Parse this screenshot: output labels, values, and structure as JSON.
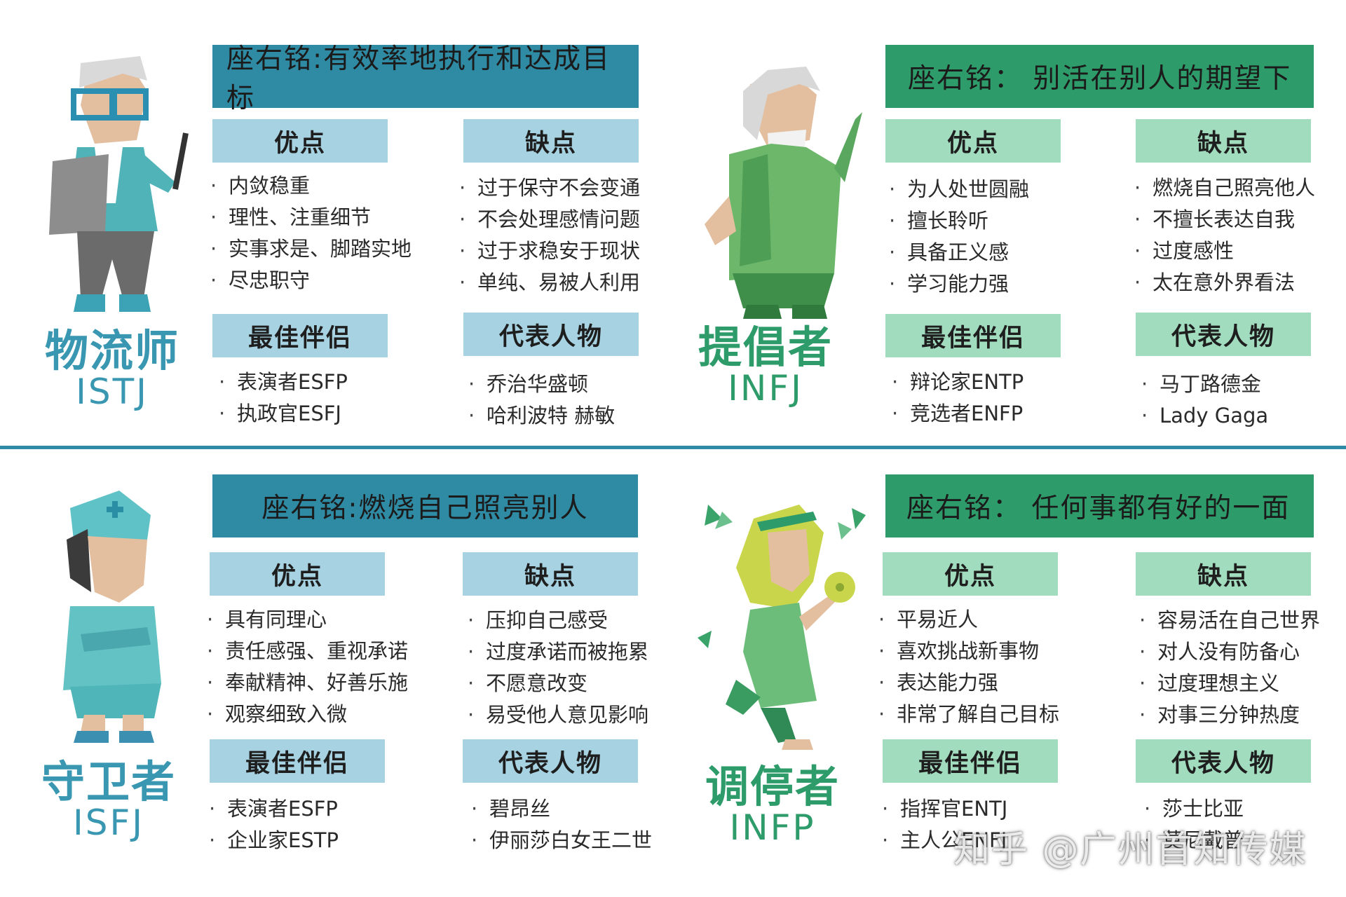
{
  "panels": {
    "istj": {
      "name": "物流师",
      "code": "ISTJ",
      "motto": "座右铭:有效率地执行和达成目标",
      "pros_label": "优点",
      "pros": [
        "内敛稳重",
        "理性、注重细节",
        "实事求是、脚踏实地",
        "尽忠职守"
      ],
      "cons_label": "缺点",
      "cons": [
        "过于保守不会变通",
        "不会处理感情问题",
        "过于求稳安于现状",
        "单纯、易被人利用"
      ],
      "partner_label": "最佳伴侣",
      "partners": [
        "表演者ESFP",
        "执政官ESFJ"
      ],
      "figures_label": "代表人物",
      "figures": [
        "乔治华盛顿",
        "哈利波特 赫敏"
      ]
    },
    "infj": {
      "name": "提倡者",
      "code": "INFJ",
      "motto": "座右铭：  别活在别人的期望下",
      "pros_label": "优点",
      "pros": [
        "为人处世圆融",
        "擅长聆听",
        "具备正义感",
        "学习能力强"
      ],
      "cons_label": "缺点",
      "cons": [
        "燃烧自己照亮他人",
        "不擅长表达自我",
        "过度感性",
        "太在意外界看法"
      ],
      "partner_label": "最佳伴侣",
      "partners": [
        "辩论家ENTP",
        "竞选者ENFP"
      ],
      "figures_label": "代表人物",
      "figures": [
        "马丁路德金",
        "Lady Gaga"
      ]
    },
    "isfj": {
      "name": "守卫者",
      "code": "ISFJ",
      "motto": "座右铭:燃烧自己照亮别人",
      "pros_label": "优点",
      "pros": [
        "具有同理心",
        "责任感强、重视承诺",
        "奉献精神、好善乐施",
        "观察细致入微"
      ],
      "cons_label": "缺点",
      "cons": [
        "压抑自己感受",
        "过度承诺而被拖累",
        "不愿意改变",
        "易受他人意见影响"
      ],
      "partner_label": "最佳伴侣",
      "partners": [
        "表演者ESFP",
        "企业家ESTP"
      ],
      "figures_label": "代表人物",
      "figures": [
        "碧昂丝",
        "伊丽莎白女王二世"
      ]
    },
    "infp": {
      "name": "调停者",
      "code": "INFP",
      "motto": "座右铭：  任何事都有好的一面",
      "pros_label": "优点",
      "pros": [
        "平易近人",
        "喜欢挑战新事物",
        "表达能力强",
        "非常了解自己目标"
      ],
      "cons_label": "缺点",
      "cons": [
        "容易活在自己世界",
        "对人没有防备心",
        "过度理想主义",
        "对事三分钟热度"
      ],
      "partner_label": "最佳伴侣",
      "partners": [
        "指挥官ENTJ",
        "主人公ENFJ"
      ],
      "figures_label": "代表人物",
      "figures": [
        "莎士比亚",
        "莫尼戴普"
      ]
    }
  },
  "bullet": "·",
  "watermark": "知乎 @广州首知传媒",
  "colors": {
    "blue_dark": "#2f8aa3",
    "blue_light": "#a6d2e1",
    "green_dark": "#2e9c6a",
    "green_light": "#a2dcbf"
  },
  "icons": {
    "istj": "glasses-man-with-pencil-figure",
    "infj": "bearded-sage-figure",
    "isfj": "nurse-figure",
    "infp": "dancing-girl-with-pinwheel-figure"
  }
}
